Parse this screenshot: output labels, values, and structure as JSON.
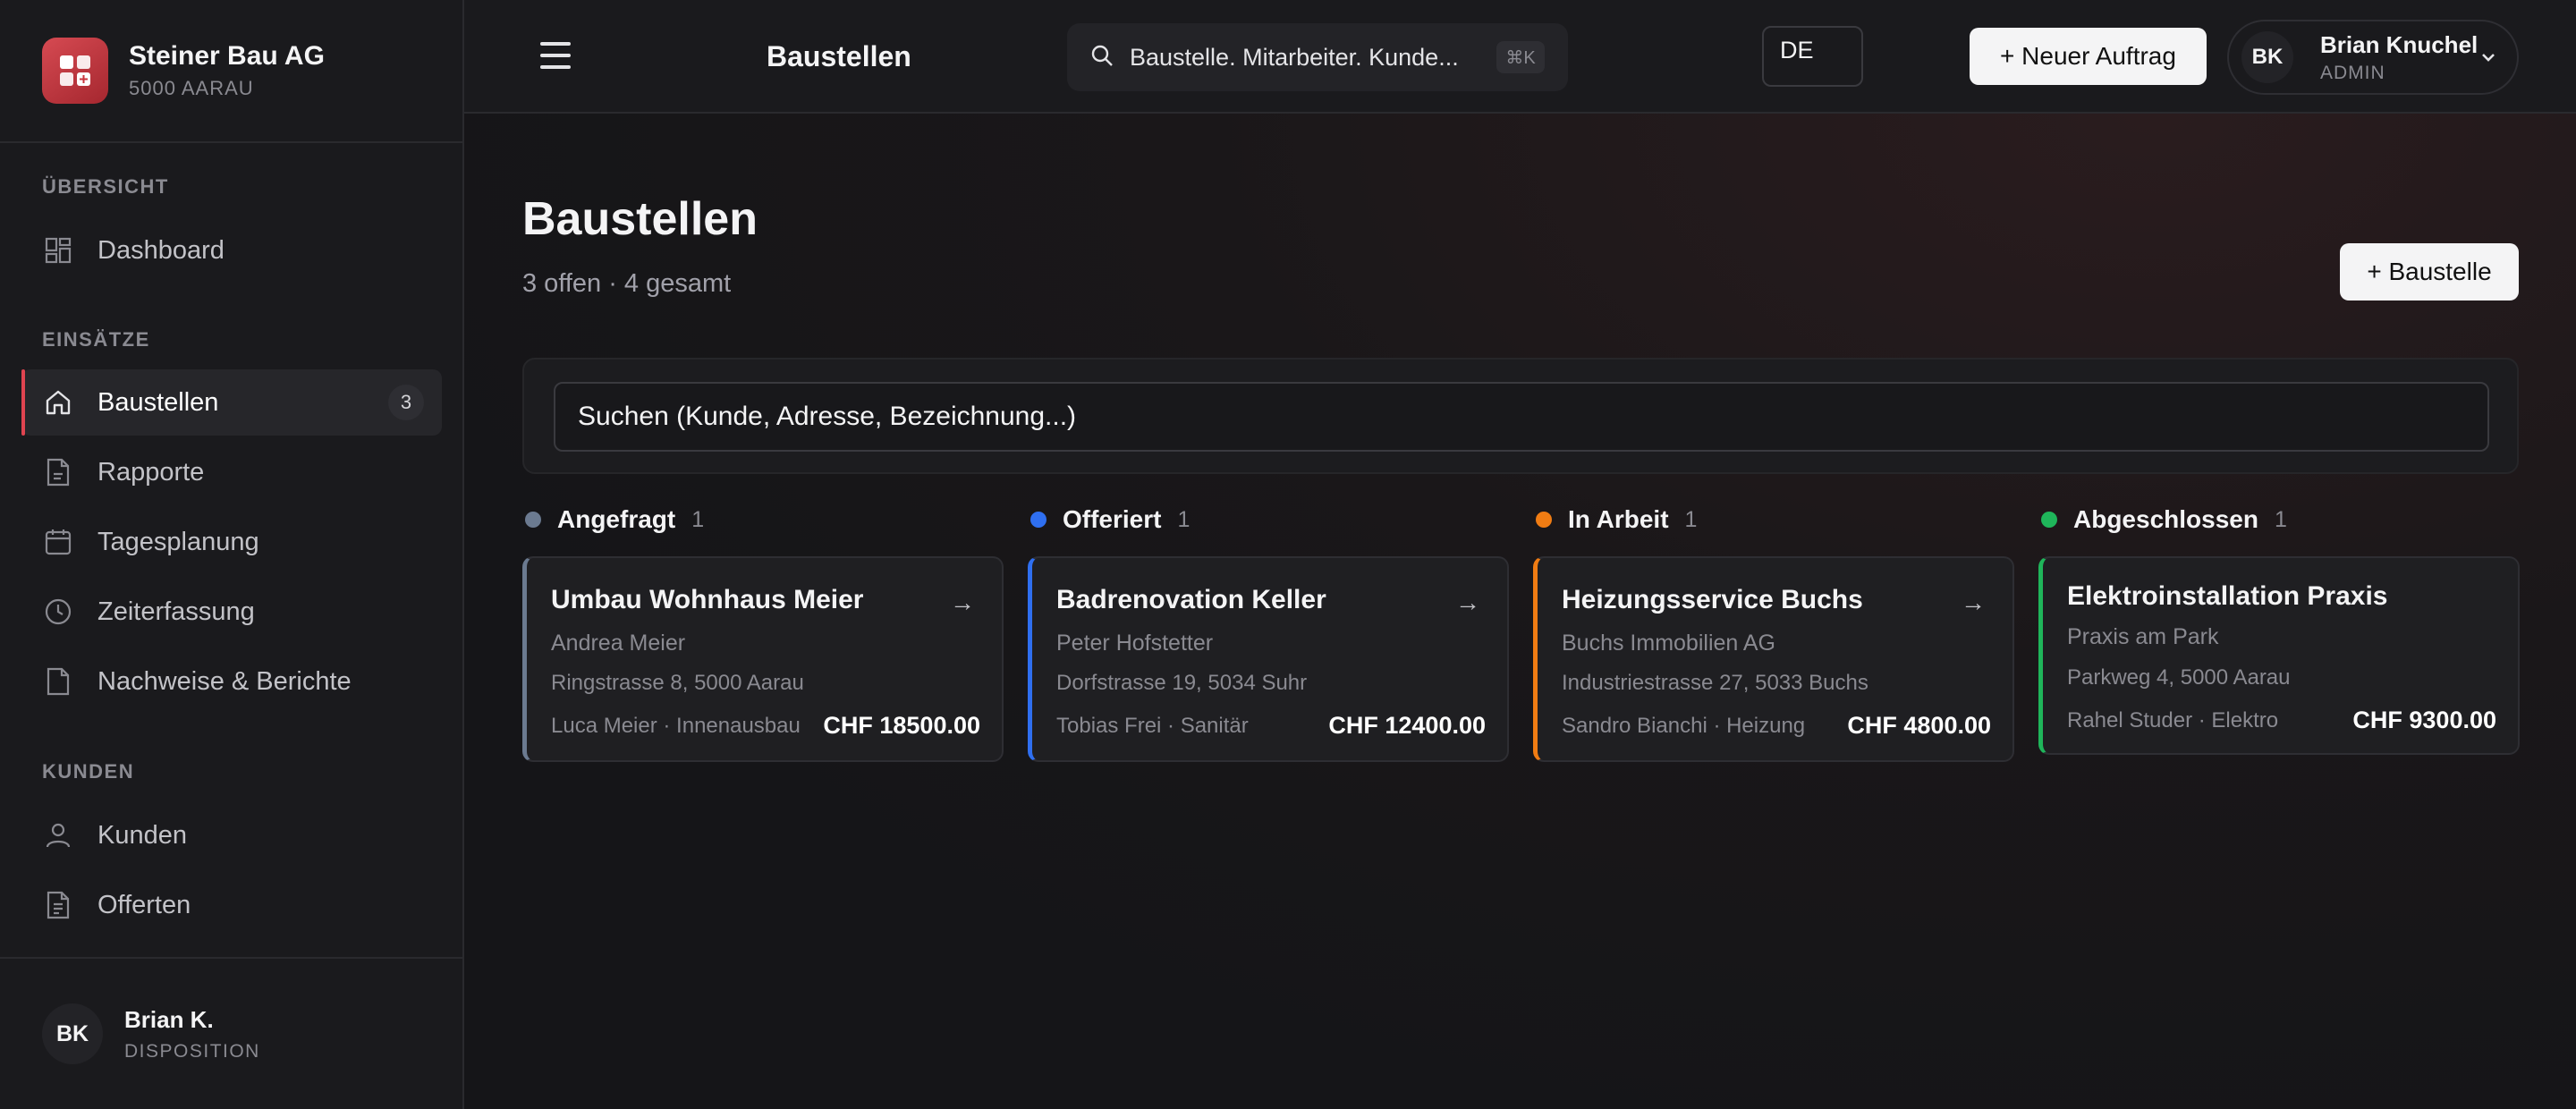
{
  "brand": {
    "name": "Steiner Bau AG",
    "subtitle": "5000 AARAU"
  },
  "sidebar": {
    "sections": [
      {
        "label": "ÜBERSICHT"
      },
      {
        "label": "EINSÄTZE"
      },
      {
        "label": "KUNDEN"
      }
    ],
    "items": [
      {
        "label": "Dashboard",
        "icon": "dashboard-grid-icon"
      },
      {
        "label": "Baustellen",
        "icon": "home-icon",
        "badge": "3",
        "active": true
      },
      {
        "label": "Rapporte",
        "icon": "document-icon"
      },
      {
        "label": "Tagesplanung",
        "icon": "calendar-icon"
      },
      {
        "label": "Zeiterfassung",
        "icon": "clock-icon"
      },
      {
        "label": "Nachweise & Berichte",
        "icon": "file-icon"
      },
      {
        "label": "Kunden",
        "icon": "user-icon"
      },
      {
        "label": "Offerten",
        "icon": "document-list-icon"
      }
    ],
    "footer": {
      "initials": "BK",
      "name": "Brian K.",
      "role": "DISPOSITION"
    }
  },
  "topbar": {
    "title": "Baustellen",
    "search_placeholder": "Baustelle. Mitarbeiter. Kunde...",
    "shortcut": "⌘K",
    "language": "DE",
    "new_order_label": "+ Neuer Auftrag",
    "user": {
      "initials": "BK",
      "name": "Brian Knuchel",
      "role": "ADMIN"
    }
  },
  "page": {
    "title": "Baustellen",
    "subtitle": "3 offen · 4 gesamt",
    "add_button": "+ Baustelle",
    "filter_placeholder": "Suchen (Kunde, Adresse, Bezeichnung...)"
  },
  "colors": {
    "accent": "#e04450",
    "angefragt": "#6b7a90",
    "offeriert": "#2f6ff0",
    "in_arbeit": "#f07c13",
    "abgeschlossen": "#1fb55a"
  },
  "columns": [
    {
      "title": "Angefragt",
      "count": "1",
      "card": {
        "title": "Umbau Wohnhaus Meier",
        "client": "Andrea Meier",
        "address": "Ringstrasse 8, 5000 Aarau",
        "team": "Luca Meier · Innenausbau",
        "amount": "CHF 18500.00"
      }
    },
    {
      "title": "Offeriert",
      "count": "1",
      "card": {
        "title": "Badrenovation Keller",
        "client": "Peter Hofstetter",
        "address": "Dorfstrasse 19, 5034 Suhr",
        "team": "Tobias Frei · Sanitär",
        "amount": "CHF 12400.00"
      }
    },
    {
      "title": "In Arbeit",
      "count": "1",
      "card": {
        "title": "Heizungsservice Buchs",
        "client": "Buchs Immobilien AG",
        "address": "Industriestrasse 27, 5033 Buchs",
        "team": "Sandro Bianchi · Heizung",
        "amount": "CHF 4800.00"
      }
    },
    {
      "title": "Abgeschlossen",
      "count": "1",
      "card": {
        "title": "Elektroinstallation Praxis",
        "client": "Praxis am Park",
        "address": "Parkweg 4, 5000 Aarau",
        "team": "Rahel Studer · Elektro",
        "amount": "CHF 9300.00"
      }
    }
  ]
}
